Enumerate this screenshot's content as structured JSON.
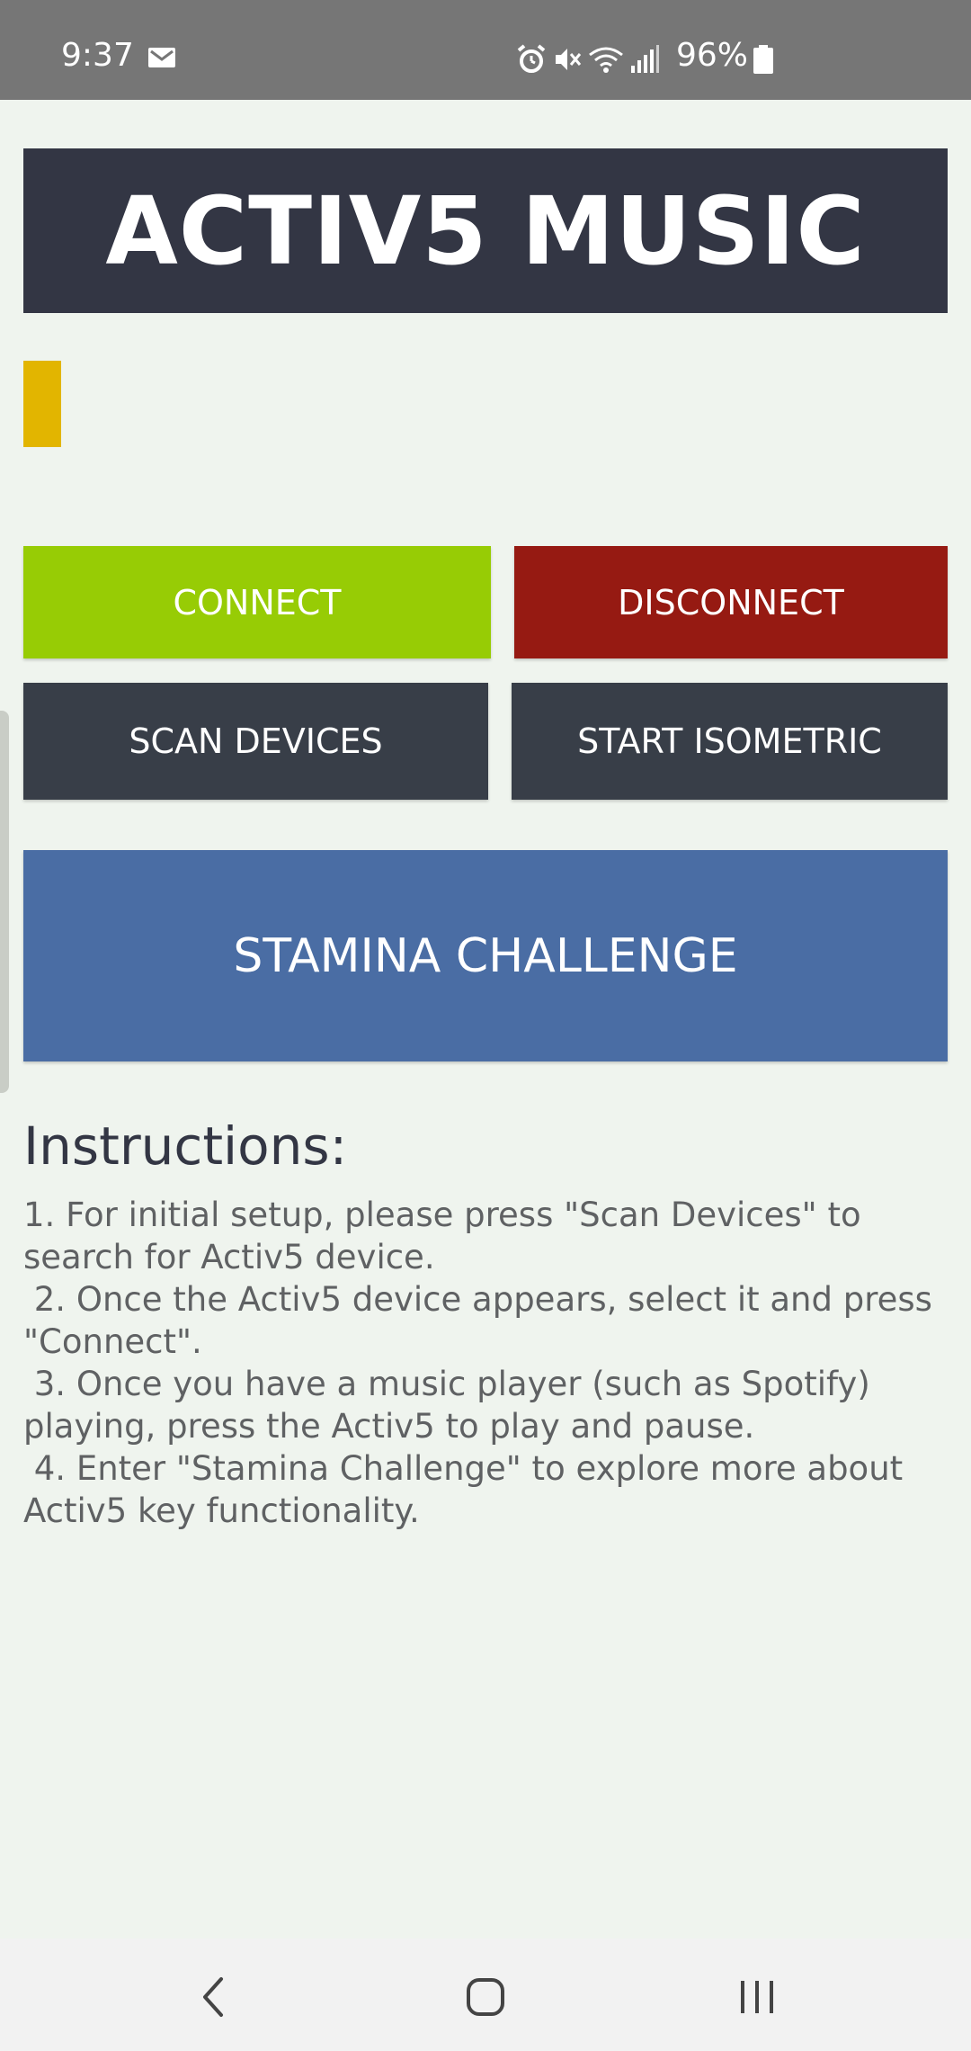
{
  "status_bar": {
    "time": "9:37",
    "battery": "96%",
    "icons": [
      "mail-icon",
      "alarm-icon",
      "mute-icon",
      "wifi-icon",
      "signal-icon",
      "battery-icon"
    ]
  },
  "app": {
    "title": "ACTIV5 MUSIC",
    "indicator_color": "#e2b500"
  },
  "buttons": {
    "connect": "CONNECT",
    "disconnect": "DISCONNECT",
    "scan": "SCAN DEVICES",
    "isometric": "START ISOMETRIC",
    "stamina": "STAMINA CHALLENGE"
  },
  "colors": {
    "connect": "#97cc05",
    "disconnect": "#961a12",
    "dark_button": "#383e48",
    "stamina": "#4a6da4",
    "title_bg": "#333644"
  },
  "instructions": {
    "heading": "Instructions:",
    "steps": [
      "1. For initial setup, please press \"Scan Devices\" to search for Activ5 device.",
      " 2. Once the Activ5 device appears, select it and press \"Connect\".",
      " 3. Once you have a music player (such as Spotify) playing, press the Activ5 to play and pause.",
      " 4. Enter \"Stamina Challenge\" to explore more about Activ5 key functionality."
    ]
  },
  "nav_bar": {
    "icons": [
      "back-icon",
      "home-icon",
      "recents-icon"
    ]
  }
}
